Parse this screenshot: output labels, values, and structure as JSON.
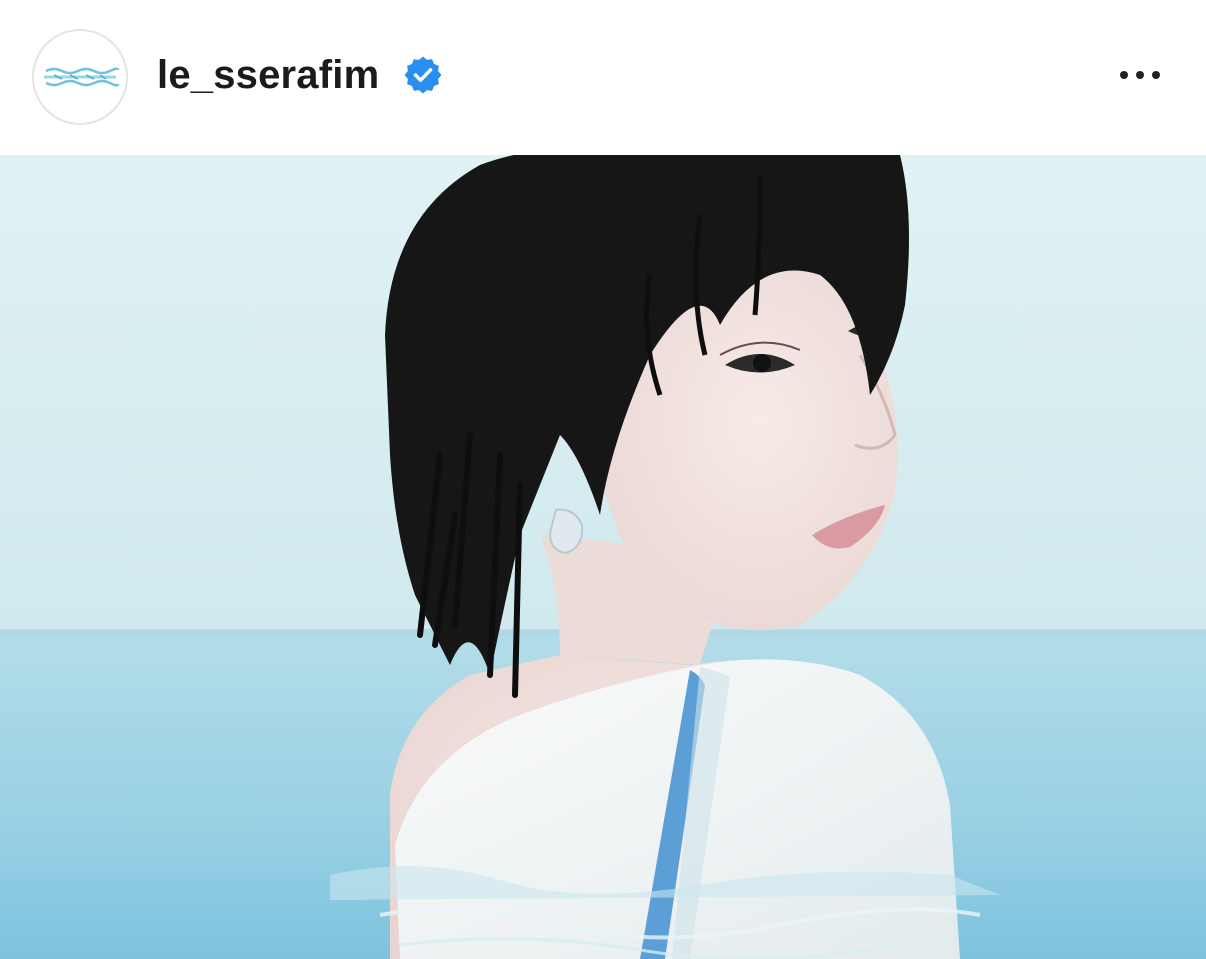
{
  "post": {
    "header": {
      "username": "le_sserafim",
      "avatar_icon": "le-sserafim-logo-icon",
      "verified_icon": "verified-badge-icon",
      "more_icon": "more-options-icon"
    },
    "media": {
      "type": "photo"
    }
  },
  "colors": {
    "username_text": "#1b1b1b",
    "verified_blue": "#2a8df0",
    "sky_top": "#dff1f3",
    "sky_bottom": "#cfe8ec",
    "water_top": "#aed9e6",
    "water_bottom": "#7fc5e0",
    "hair": "#161616",
    "skin": "#f3e4e0",
    "shirt": "#f5f7f6",
    "strap": "#5c9fd6"
  }
}
